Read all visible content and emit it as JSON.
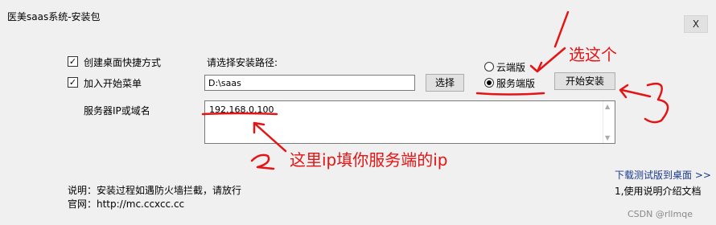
{
  "window": {
    "title": "医美saas系统-安装包",
    "close_label": "X"
  },
  "options": {
    "desktop_shortcut": {
      "label": "创建桌面快捷方式",
      "checked": true
    },
    "start_menu": {
      "label": "加入开始菜单",
      "checked": true
    }
  },
  "install_path": {
    "label": "请选择安装路径:",
    "value": "D:\\saas",
    "browse_label": "选择"
  },
  "edition": {
    "cloud_label": "云端版",
    "server_label": "服务端版",
    "selected": "server"
  },
  "install_button_label": "开始安装",
  "server": {
    "label": "服务器IP或域名",
    "value": "192.168.0.100"
  },
  "annotations": {
    "pick_this": "选这个",
    "ip_hint": "这里ip填你服务端的ip",
    "num1": "1",
    "num2": "2",
    "num3": "3"
  },
  "footer": {
    "note": "说明：安装过程如遇防火墙拦截，请放行",
    "website": "官网：http://mc.ccxcc.cc",
    "download_link": "下载测试版到桌面 >>",
    "manual_link": "1,使用说明介绍文档"
  },
  "watermark": "CSDN @rllmqe",
  "colors": {
    "annotation": "#e51414",
    "link": "#1a3a8a",
    "background": "#f0f0f0"
  }
}
